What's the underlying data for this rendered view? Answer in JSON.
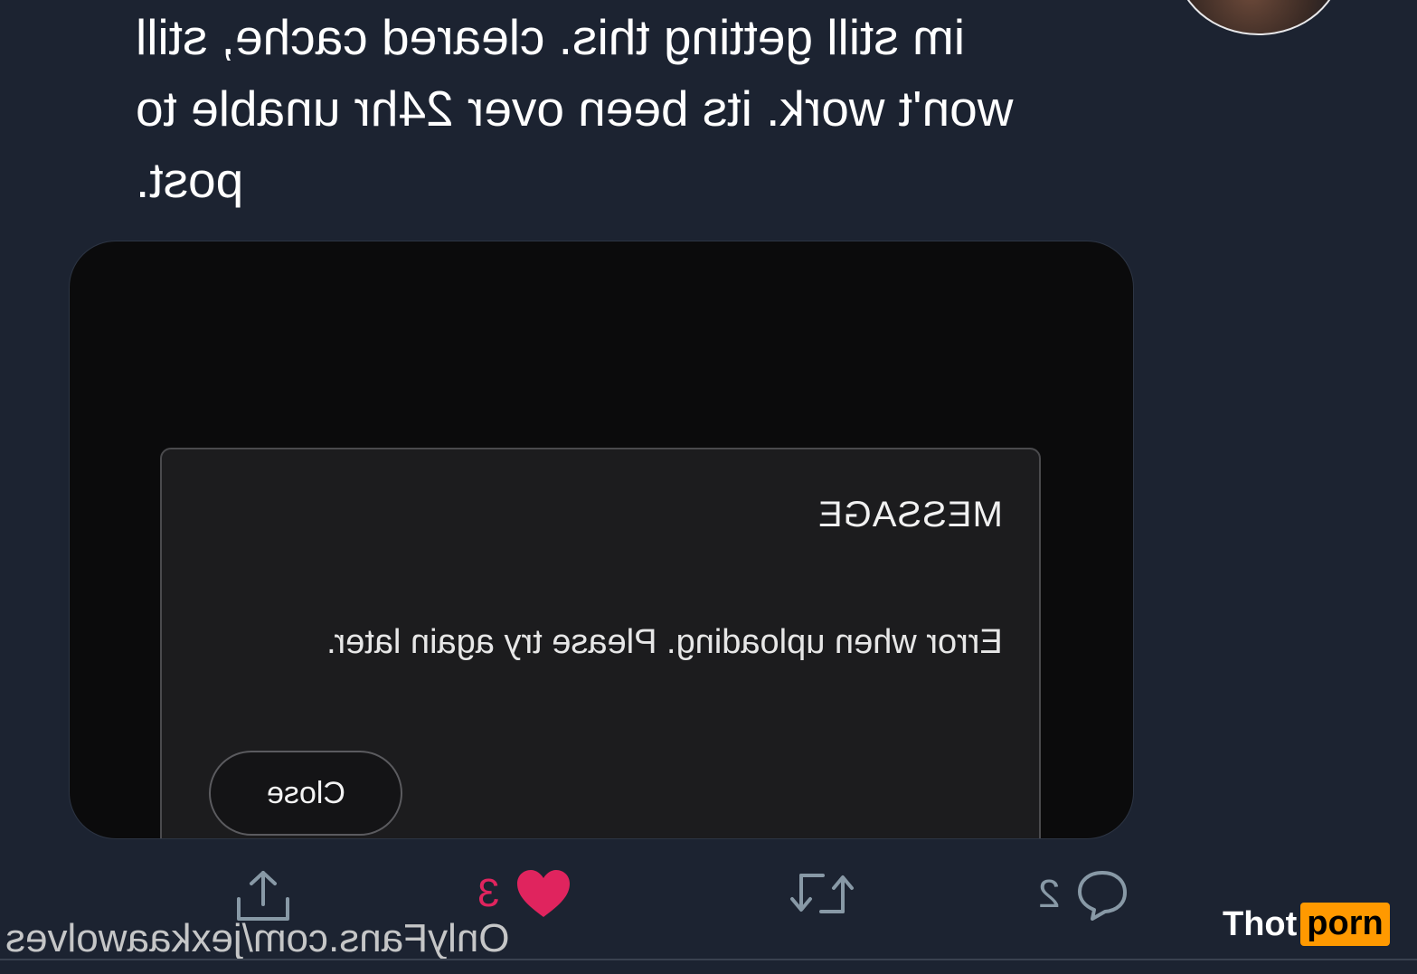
{
  "tweet": {
    "text_lines": [
      "im still getting this. cleared cache, still",
      "won't work. its been over 24hr unable to",
      "post."
    ]
  },
  "dialog": {
    "title": "MESSAGE",
    "message": "Error when uploading. Please try again later.",
    "close_label": "Close"
  },
  "actions": {
    "reply_count": "2",
    "retweet_count": "",
    "like_count": "3",
    "like_color": "#e0245e",
    "icon_color": "#8899a6"
  },
  "overlay": {
    "watermark_url": "OnlyFans.com/jexkaawolves",
    "brand_part1": "Thot",
    "brand_part2": "porn",
    "brand_accent": "#ff9900"
  }
}
